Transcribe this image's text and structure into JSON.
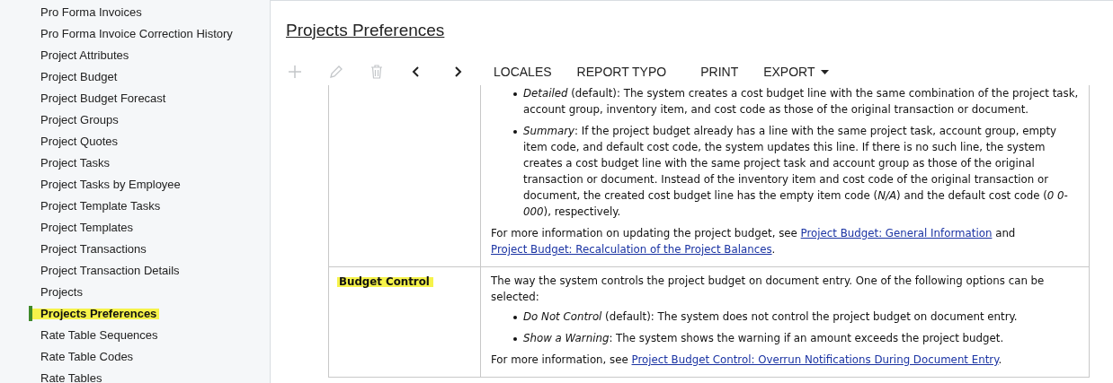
{
  "sidebar": {
    "items": [
      {
        "label": "Pro Forma Invoices",
        "selected": false
      },
      {
        "label": "Pro Forma Invoice Correction History",
        "selected": false
      },
      {
        "label": "Project Attributes",
        "selected": false
      },
      {
        "label": "Project Budget",
        "selected": false
      },
      {
        "label": "Project Budget Forecast",
        "selected": false
      },
      {
        "label": "Project Groups",
        "selected": false
      },
      {
        "label": "Project Quotes",
        "selected": false
      },
      {
        "label": "Project Tasks",
        "selected": false
      },
      {
        "label": "Project Tasks by Employee",
        "selected": false
      },
      {
        "label": "Project Template Tasks",
        "selected": false
      },
      {
        "label": "Project Templates",
        "selected": false
      },
      {
        "label": "Project Transactions",
        "selected": false
      },
      {
        "label": "Project Transaction Details",
        "selected": false
      },
      {
        "label": "Projects",
        "selected": false
      },
      {
        "label": "Projects Preferences",
        "selected": true
      },
      {
        "label": "Rate Table Sequences",
        "selected": false
      },
      {
        "label": "Rate Table Codes",
        "selected": false
      },
      {
        "label": "Rate Tables",
        "selected": false
      }
    ]
  },
  "page_title": "Projects Preferences",
  "toolbar": [
    {
      "kind": "add",
      "disabled": true
    },
    {
      "kind": "edit",
      "disabled": true
    },
    {
      "kind": "delete",
      "disabled": true
    },
    {
      "kind": "previous",
      "disabled": false
    },
    {
      "kind": "next",
      "disabled": false
    },
    {
      "kind": "text",
      "label": "LOCALES"
    },
    {
      "kind": "text",
      "label": "REPORT TYPO"
    },
    {
      "kind": "text",
      "label": "PRINT"
    },
    {
      "kind": "menu",
      "label": "EXPORT"
    }
  ],
  "table": {
    "rows": [
      {
        "name": null,
        "blocks": [
          {
            "kind": "bullets",
            "items": [
              "*Detailed* (default): The system creates a cost budget line with the same combination of the project task, account group, inventory item, and cost code as those of the original transaction or document.",
              "*Summary*: If the project budget already has a line with the same project task, account group, empty item code, and default cost code, the system updates this line. If there is no such line, the system creates a cost budget line with the same project task and account group as those of the original transaction or document. Instead of the inventory item and cost code of the original transaction or document, the created cost budget line has the empty item code (*N/A*) and the default cost code (*0 0-000*), respectively."
            ]
          },
          {
            "kind": "paragraph",
            "parts": [
              {
                "text": "For more information on updating the project budget, see ",
                "kind": "text"
              },
              {
                "text": "Project Budget: General Information",
                "kind": "link"
              },
              {
                "text": " and ",
                "kind": "text"
              },
              {
                "text": "Project Budget: Recalculation of the Project Balances",
                "kind": "link"
              },
              {
                "text": ".",
                "kind": "text"
              }
            ]
          }
        ]
      },
      {
        "name": {
          "text": "Budget Control",
          "highlighted": true
        },
        "blocks": [
          {
            "kind": "paragraph",
            "parts": [
              {
                "text": "The way the system controls the project budget on document entry. One of the following options can be selected:",
                "kind": "text"
              }
            ]
          },
          {
            "kind": "bullets",
            "items": [
              "*Do Not Control* (default): The system does not control the project budget on document entry.",
              "*Show a Warning*: The system shows the warning if an amount exceeds the project budget."
            ]
          },
          {
            "kind": "paragraph",
            "parts": [
              {
                "text": "For more information, see ",
                "kind": "text"
              },
              {
                "text": "Project Budget Control: Overrun Notifications During Document Entry",
                "kind": "link"
              },
              {
                "text": ".",
                "kind": "text"
              }
            ]
          }
        ]
      }
    ]
  }
}
